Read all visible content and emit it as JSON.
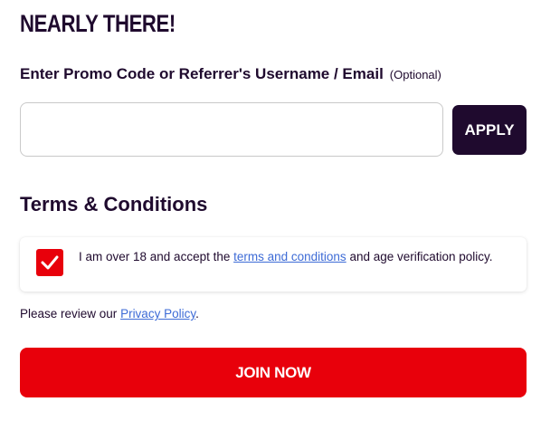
{
  "title": "NEARLY THERE!",
  "promo": {
    "label": "Enter Promo Code or Referrer's Username / Email",
    "optional": "(Optional)",
    "value": "",
    "placeholder": "",
    "apply_label": "APPLY"
  },
  "terms": {
    "heading": "Terms & Conditions",
    "checked": true,
    "text_before": "I am over 18 and accept the ",
    "link_text": "terms and conditions",
    "text_after": " and age verification policy."
  },
  "privacy": {
    "text_before": "Please review our ",
    "link_text": "Privacy Policy",
    "text_after": "."
  },
  "join_label": "JOIN NOW",
  "icons": {
    "checkbox": "checkmark-icon"
  },
  "colors": {
    "dark": "#1f0a2e",
    "red": "#e8000b",
    "link": "#3d6bd6"
  }
}
